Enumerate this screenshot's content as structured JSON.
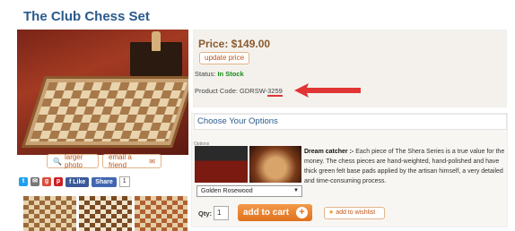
{
  "page": {
    "title": "The Club Chess Set"
  },
  "gallery": {
    "larger_photo_label": "larger photo",
    "email_friend_label": "email a friend",
    "social": {
      "like_label": "Like",
      "share_label": "Share",
      "share_count": "1"
    }
  },
  "price": {
    "label": "Price: $149.00",
    "update_label": "update price",
    "status_label": "Status:",
    "status_value": "In Stock",
    "code_label": "Product Code: GDRSW-",
    "code_value": "3259"
  },
  "options": {
    "heading": "Choose Your Options",
    "section_label": "Options",
    "description_title": "Dream catcher :-",
    "description_body": " Each piece of The Shera Series is a true value for the money. The chess pieces are hand-weighted, hand-polished and have thick green felt base pads applied by the artisan himself, a very detailed and time-consuming process.",
    "selected_option": "Golden Rosewood"
  },
  "purchase": {
    "qty_label": "Qty:",
    "qty_value": "1",
    "add_to_cart_label": "add to cart",
    "wishlist_label": "add to wishlist"
  },
  "colors": {
    "title": "#2a5a8c",
    "accent": "#e0701c",
    "annotation_arrow": "#e13434",
    "in_stock": "#1a8a1a"
  }
}
